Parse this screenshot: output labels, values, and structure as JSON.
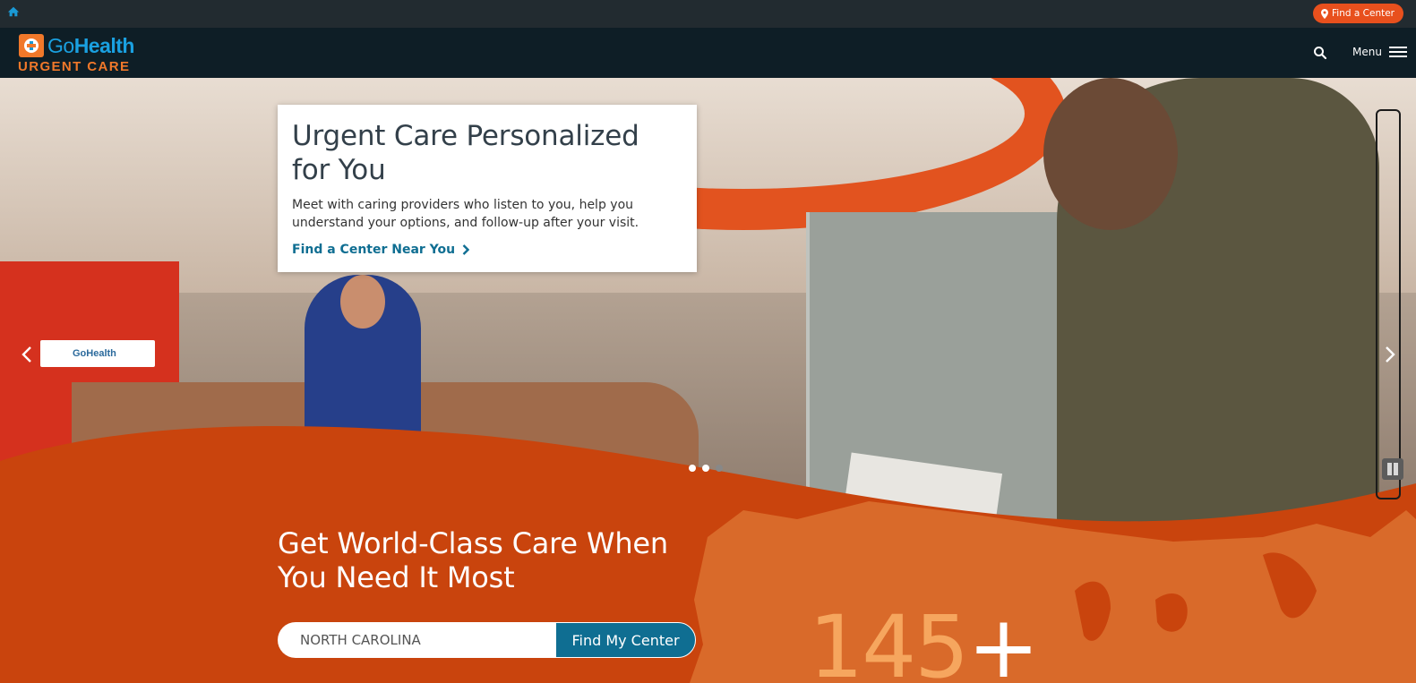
{
  "utility_bar": {
    "find_center_label": "Find a Center"
  },
  "header": {
    "logo_primary_a": "Go",
    "logo_primary_b": "Health",
    "logo_secondary": "URGENT CARE",
    "menu_label": "Menu"
  },
  "hero": {
    "wall_sign": "GoHealth",
    "card": {
      "title": "Urgent Care Personalized for You",
      "text": "Meet with caring providers who listen to you, help you understand your options, and follow-up after your visit.",
      "link_label": "Find a Center Near You"
    },
    "slides": {
      "count": 3,
      "active_index": 0
    }
  },
  "find_section": {
    "title": "Get World-Class Care When You Need It Most",
    "search_value": "NORTH CAROLINA",
    "button_label": "Find My Center"
  },
  "stat": {
    "number": "145",
    "suffix": "+"
  },
  "colors": {
    "brand_orange": "#e8501d",
    "section_orange": "#c9440d",
    "button_blue": "#0f6e92",
    "header_dark": "#0e1e26"
  }
}
